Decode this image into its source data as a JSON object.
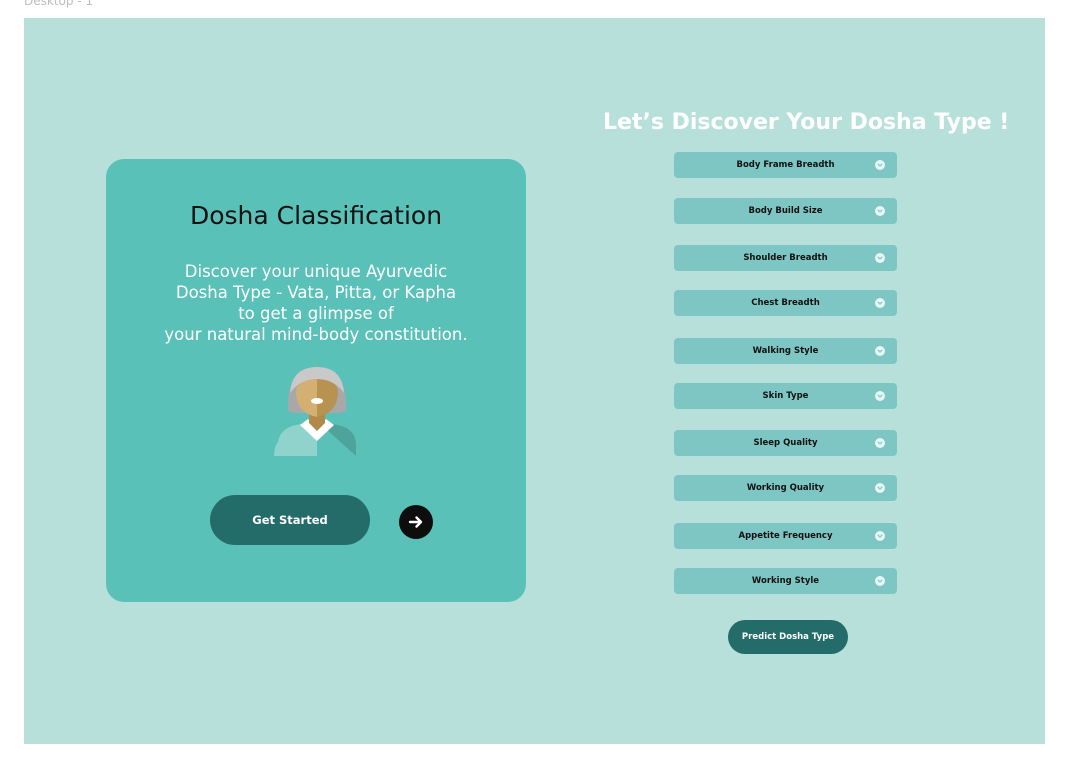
{
  "frame_label": "Desktop - 1",
  "card": {
    "title": "Dosha Classification",
    "description_lines": [
      "Discover your unique Ayurvedic",
      "Dosha Type - Vata, Pitta, or Kapha",
      "to get a glimpse of",
      "your natural mind-body constitution."
    ],
    "button_label": "Get Started",
    "avatar_icon": "person-avatar-icon",
    "arrow_icon": "arrow-right-icon"
  },
  "form": {
    "title": "Let’s Discover Your Dosha Type !",
    "fields": [
      {
        "label": "Body Frame Breadth"
      },
      {
        "label": "Body Build Size"
      },
      {
        "label": "Shoulder Breadth"
      },
      {
        "label": "Chest Breadth"
      },
      {
        "label": "Walking Style"
      },
      {
        "label": "Skin Type"
      },
      {
        "label": "Sleep Quality"
      },
      {
        "label": "Working Quality"
      },
      {
        "label": "Appetite Frequency"
      },
      {
        "label": "Working Style"
      }
    ],
    "submit_label": "Predict Dosha Type",
    "dropdown_icon": "chevron-down-icon"
  },
  "colors": {
    "background": "#b8e0db",
    "card": "#5ac1b9",
    "button": "#246c69",
    "field": "#7dc6c3"
  }
}
